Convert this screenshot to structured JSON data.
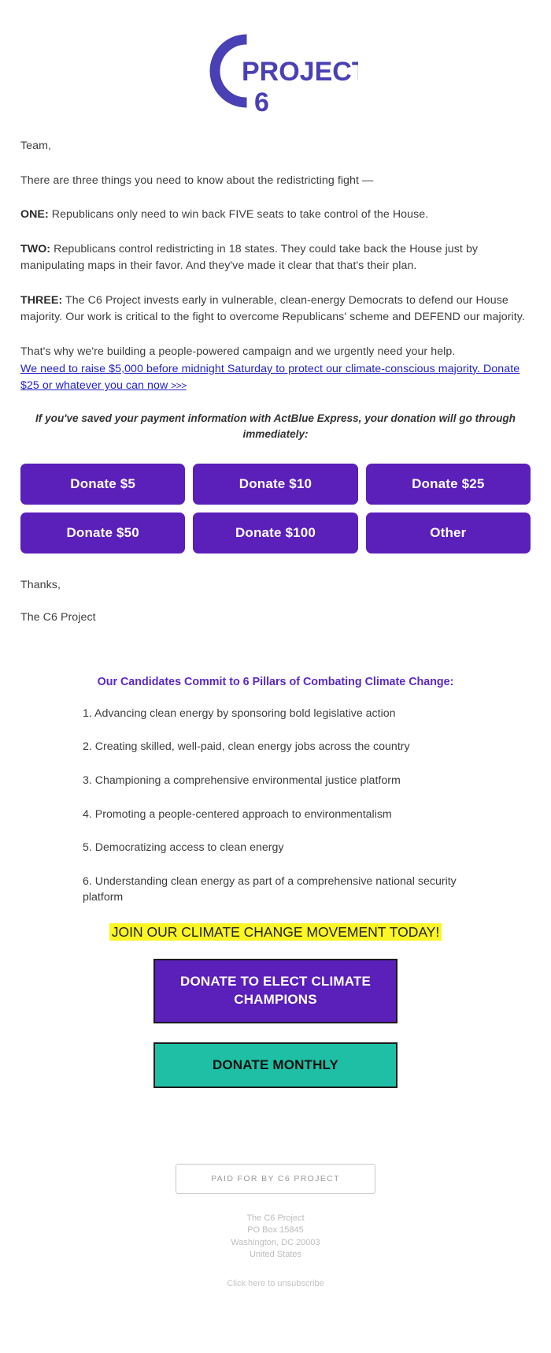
{
  "brand": {
    "logo_name": "c6-project-logo",
    "logo_word": "PROJECT",
    "logo_numeral": "6",
    "logo_letter": "C",
    "purple": "#4a40b5",
    "button_purple": "#5b1fba",
    "link_blue": "#2323c8",
    "teal": "#1ebfa5",
    "highlight_yellow": "#fbf624"
  },
  "body": {
    "greeting": "Team,",
    "intro": "There are three things you need to know about the redistricting fight —",
    "point_one_label": "ONE:",
    "point_one_text": " Republicans only need to win back FIVE seats to take control of the House.",
    "point_two_label": "TWO:",
    "point_two_text": " Republicans control redistricting in 18 states. They could take back the House just by manipulating maps in their favor. And they've made it clear that that's their plan.",
    "point_three_label": "THREE:",
    "point_three_text": " The C6 Project invests early in vulnerable, clean-energy Democrats to defend our House majority. Our work is critical to the fight to overcome Republicans' scheme and DEFEND our majority.",
    "closing_ask": "That's why we're building a people-powered campaign and we urgently need your help.",
    "link_text": "We need to raise $5,000 before midnight Saturday to protect our climate-conscious majority. Donate $25 or whatever you can now",
    "link_chevrons": ">>>",
    "express_note": "If you've saved your payment information with ActBlue Express, your donation will go through immediately:",
    "sign_thanks": "Thanks,",
    "sign_name": "The C6 Project"
  },
  "donate_buttons": [
    {
      "label": "Donate $5",
      "amount": "5"
    },
    {
      "label": "Donate $10",
      "amount": "10"
    },
    {
      "label": "Donate $25",
      "amount": "25"
    },
    {
      "label": "Donate $50",
      "amount": "50"
    },
    {
      "label": "Donate $100",
      "amount": "100"
    },
    {
      "label": "Other",
      "amount": "other"
    }
  ],
  "pillars": {
    "title": "Our Candidates Commit to 6 Pillars of Combating Climate Change:",
    "items": [
      "1. Advancing clean energy by sponsoring bold legislative action",
      "2. Creating skilled, well-paid, clean energy jobs across the country",
      "3. Championing a comprehensive environmental justice platform",
      "4. Promoting a people-centered approach to environmentalism",
      "5. Democratizing access to clean energy",
      "6. Understanding clean energy as part of a comprehensive national security platform"
    ]
  },
  "cta": {
    "highlight": "JOIN OUR CLIMATE CHANGE MOVEMENT TODAY!",
    "primary_label": "DONATE TO ELECT CLIMATE CHAMPIONS",
    "secondary_label": "DONATE MONTHLY"
  },
  "footer": {
    "paid_for": "PAID FOR BY C6 PROJECT",
    "org": "The C6 Project",
    "po_box": "PO Box 15845",
    "city_state_zip": "Washington, DC 20003",
    "country": "United States",
    "unsubscribe": "Click here to unsubscribe"
  }
}
